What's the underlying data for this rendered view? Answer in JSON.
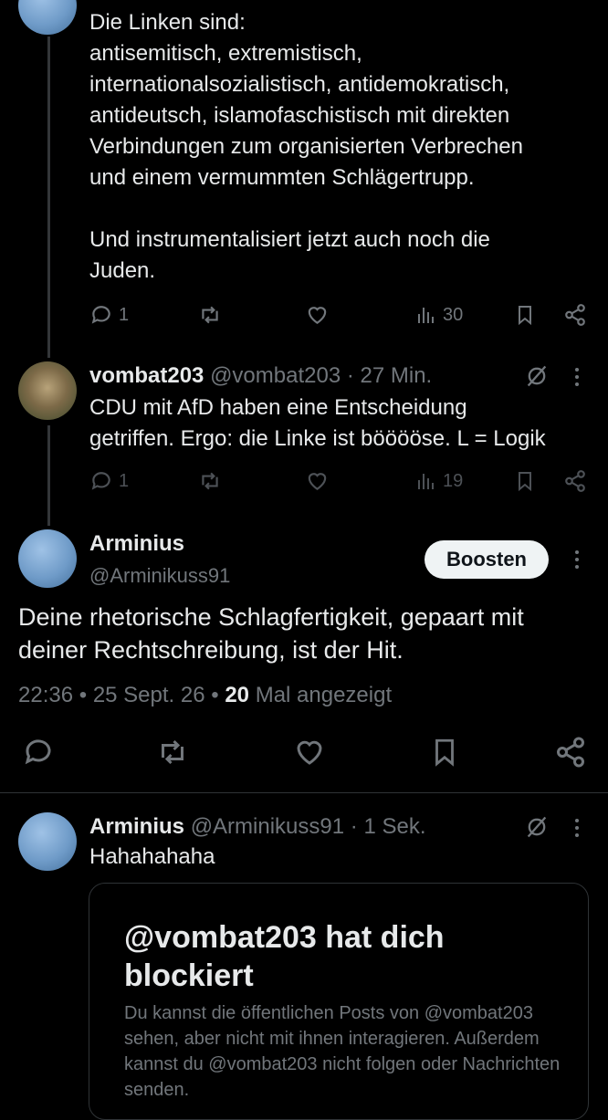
{
  "post1": {
    "text": "Die Linken sind:\nantisemitisch, extremistisch,\ninternationalsozialistisch, antidemokratisch,\nantideutsch, islamofaschistisch mit direkten\nVerbindungen zum organisierten Verbrechen\nund einem vermummten Schlägertrupp.\n\nUnd instrumentalisiert jetzt auch noch die\nJuden.",
    "replies": "1",
    "views": "30"
  },
  "post2": {
    "name": "vombat203",
    "handle": "@vombat203",
    "sep": "·",
    "time": "27 Min.",
    "text": "CDU mit AfD haben eine Entscheidung\ngetriffen. Ergo: die Linke ist bööööse. L = Logik",
    "replies": "1",
    "views": "19"
  },
  "main_post": {
    "name": "Arminius",
    "handle": "@Arminikuss91",
    "follow_label": "Boosten",
    "text": "Deine rhetorische Schlagfertigkeit, gepaart mit\ndeiner Rechtschreibung, ist der Hit.",
    "time": "22:36",
    "date": "25 Sept. 26",
    "views_count": "20",
    "views_label": "Mal angezeigt",
    "sep": "•"
  },
  "reply": {
    "name": "Arminius",
    "handle": "@Arminikuss91",
    "sep": "·",
    "time": "1 Sek.",
    "text": "Hahahahaha"
  },
  "blocked_card": {
    "title": "@vombat203 hat dich blockiert",
    "description": "Du kannst die öffentlichen Posts von @vombat203 sehen, aber nicht mit ihnen interagieren. Außerdem kannst du @vombat203 nicht folgen oder Nachrichten senden."
  },
  "icons": [
    "reply-icon",
    "repost-icon",
    "like-icon",
    "views-icon",
    "bookmark-icon",
    "share-icon",
    "grok-icon",
    "more-icon"
  ]
}
